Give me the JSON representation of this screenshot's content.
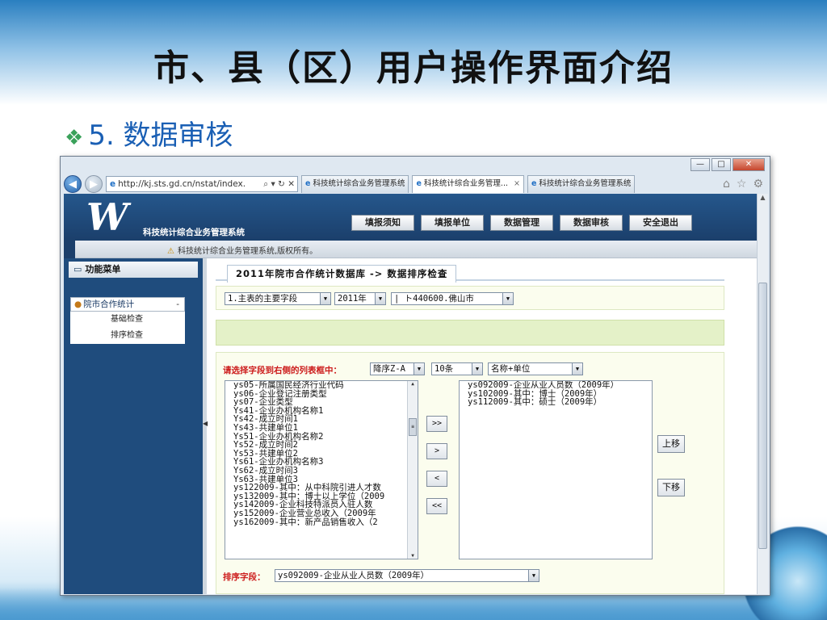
{
  "slide": {
    "title": "市、县（区）用户操作界面介绍",
    "bullet_marker": "❖",
    "bullet": "5. 数据审核"
  },
  "browser": {
    "address": "http://kj.sts.gd.cn/nstat/index.",
    "address_controls": "⌕ ▾ ↻ ✕",
    "tabs": [
      {
        "label": "科技统计综合业务管理系统",
        "active": false
      },
      {
        "label": "科技统计综合业务管理...",
        "active": true,
        "closable": true
      },
      {
        "label": "科技统计综合业务管理系统",
        "active": false
      }
    ],
    "toolbar_icons": [
      "home-icon",
      "star-icon",
      "gear-icon"
    ]
  },
  "app": {
    "logo": "W",
    "name": "科技统计综合业务管理系统",
    "nav": [
      "填报须知",
      "填报单位",
      "数据管理",
      "数据审核",
      "安全退出"
    ],
    "notice": "科技统计综合业务管理系统,版权所有。"
  },
  "sidebar": {
    "title": "功能菜单",
    "group": "院市合作统计",
    "group_caret": "-",
    "items": [
      "基础检查",
      "排序检查"
    ]
  },
  "content": {
    "panel_title": "2011年院市合作统计数据库 -> 数据排序检查",
    "filters": {
      "field": "1.主表的主要字段",
      "year": "2011年",
      "region": "| ト440600.佛山市"
    },
    "sort_prompt": "请选择字段到右侧的列表框中：",
    "order": "降序Z-A",
    "count": "10条",
    "display": "名称+单位",
    "left_list": [
      "ys05-所属国民经济行业代码",
      "ys06-企业登记注册类型",
      "ys07-企业类型",
      "Ys41-企业办机构名称1",
      "Ys42-成立时间1",
      "Ys43-共建单位1",
      "Ys51-企业办机构名称2",
      "Ys52-成立时间2",
      "Ys53-共建单位2",
      "Ys61-企业办机构名称3",
      "Ys62-成立时间3",
      "Ys63-共建单位3",
      "ys122009-其中：从中科院引进人才数",
      "ys132009-其中：博士以上学位（2009",
      "ys142009-企业科技特派员入驻人数",
      "ys152009-企业营业总收入（2009年",
      "ys162009-其中：新产品销售收入（2"
    ],
    "right_list": [
      "ys092009-企业从业人员数（2009年）",
      "ys102009-其中：博士（2009年）",
      "ys112009-其中：硕士（2009年）"
    ],
    "move_buttons": [
      ">>",
      ">",
      "<",
      "<<"
    ],
    "up_label": "上移",
    "down_label": "下移",
    "sort_field_label": "排序字段：",
    "sort_field_value": "ys092009-企业从业人员数（2009年）"
  }
}
